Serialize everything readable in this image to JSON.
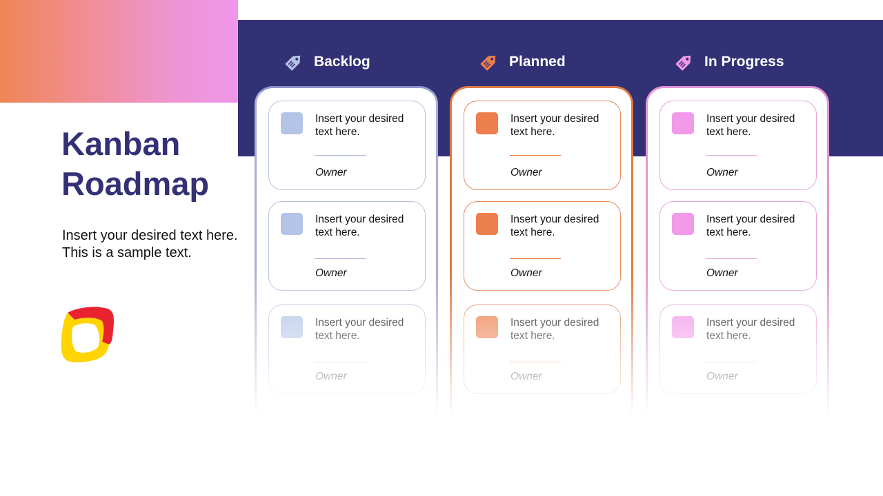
{
  "slide": {
    "title_line1": "Kanban",
    "title_line2": "Roadmap",
    "description": "Insert your desired text here. This is a sample text.",
    "colors": {
      "navy": "#333175",
      "backlog": "#b4c4e8",
      "planned": "#ed7e4d",
      "in_progress": "#f19ae9",
      "gradient_start": "#ef8654",
      "gradient_end": "#ef96ea"
    },
    "logo_icon": "logo-mark-icon"
  },
  "columns": [
    {
      "label": "Backlog",
      "icon": "tag-icon",
      "cards": [
        {
          "text": "Insert your desired text here.",
          "owner": "Owner"
        },
        {
          "text": "Insert your desired text here.",
          "owner": "Owner"
        },
        {
          "text": "Insert your desired text here.",
          "owner": "Owner"
        }
      ]
    },
    {
      "label": "Planned",
      "icon": "tag-icon",
      "cards": [
        {
          "text": "Insert your desired text here.",
          "owner": "Owner"
        },
        {
          "text": "Insert your desired text here.",
          "owner": "Owner"
        },
        {
          "text": "Insert your desired text here.",
          "owner": "Owner"
        }
      ]
    },
    {
      "label": "In Progress",
      "icon": "tag-icon",
      "cards": [
        {
          "text": "Insert your desired text here.",
          "owner": "Owner"
        },
        {
          "text": "Insert your desired text here.",
          "owner": "Owner"
        },
        {
          "text": "Insert your desired text here.",
          "owner": "Owner"
        }
      ]
    }
  ]
}
